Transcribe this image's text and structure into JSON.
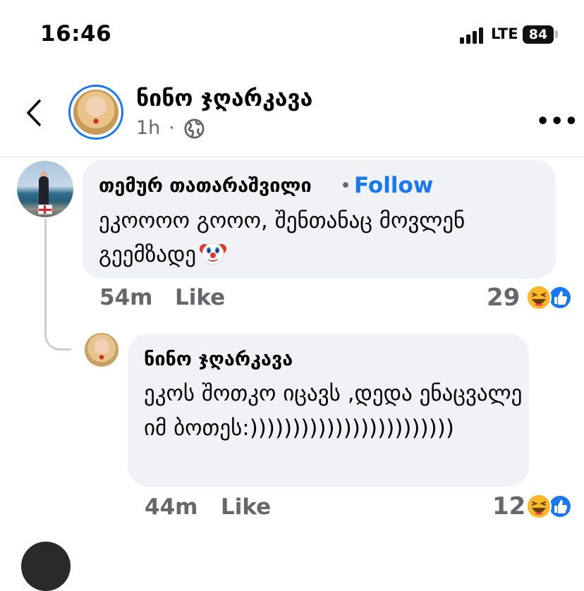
{
  "status_bar": {
    "time": "16:46",
    "network": "LTE",
    "battery": "84"
  },
  "header": {
    "author": "ნინო ჯღარკავა",
    "time": "1h",
    "separator": "·",
    "privacy_icon": "globe-icon",
    "more_icon": "more-horizontal-icon",
    "more_label": "•••",
    "back_icon": "chevron-left-icon"
  },
  "comments": [
    {
      "author": "თემურ თათარაშვილი",
      "dot": "•",
      "follow_label": "Follow",
      "text": "ეკოოოო გოოო, შენთანაც მოვლენ გეემზადე",
      "emoji": "clown-face-icon",
      "time": "54m",
      "like_label": "Like",
      "reaction_count": "29",
      "reactions": [
        "haha",
        "like"
      ]
    }
  ],
  "reply": {
    "author": "ნინო ჯღარკავა",
    "text": "ეკოს შოთკო იცავს ,დედა ენაცვალე იმ ბოთეს:))))))))))))))))))))))))",
    "time": "44m",
    "like_label": "Like",
    "reaction_count": "12",
    "reactions": [
      "haha",
      "like"
    ]
  },
  "colors": {
    "accent": "#1877f2",
    "bubble": "#f0f2f5",
    "secondary_text": "#65676b",
    "haha": "#f7b928"
  }
}
